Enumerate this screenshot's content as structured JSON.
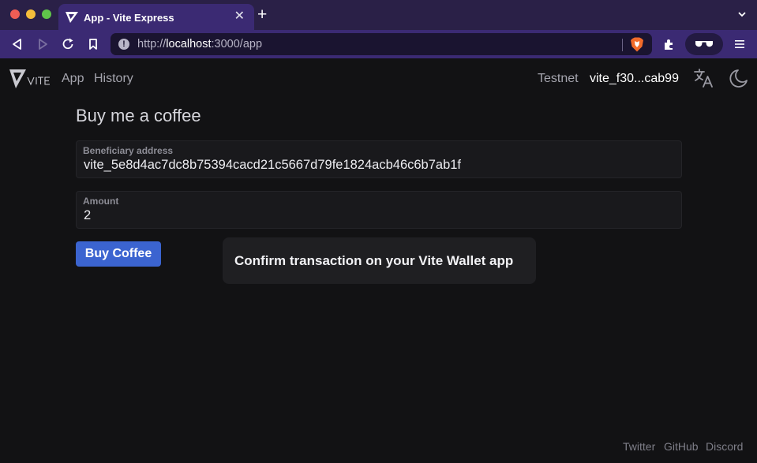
{
  "browser": {
    "tab_title": "App - Vite Express",
    "tab_close": "✕",
    "new_tab": "+",
    "url_scheme": "http://",
    "url_host": "localhost",
    "url_rest": ":3000/app",
    "info_glyph": "!"
  },
  "nav": {
    "app_label": "App",
    "history_label": "History",
    "network": "Testnet",
    "account": "vite_f30...cab99"
  },
  "page": {
    "title": "Buy me a coffee",
    "beneficiary_label": "Beneficiary address",
    "beneficiary_value": "vite_5e8d4ac7dc8b75394cacd21c5667d79fe1824acb46c6b7ab1f",
    "amount_label": "Amount",
    "amount_value": "2",
    "buy_button": "Buy Coffee",
    "toast": "Confirm transaction on your Vite Wallet app"
  },
  "footer": {
    "twitter": "Twitter",
    "github": "GitHub",
    "discord": "Discord"
  },
  "icons": [
    "vite-logo-icon",
    "back-icon",
    "forward-icon",
    "reload-icon",
    "bookmark-icon",
    "info-icon",
    "brave-shield-icon",
    "extensions-icon",
    "glasses-icon",
    "menu-icon",
    "translate-icon",
    "moon-icon"
  ],
  "colors": {
    "accent": "#3b64d0",
    "chrome": "#3b2a73",
    "background": "#121214"
  }
}
